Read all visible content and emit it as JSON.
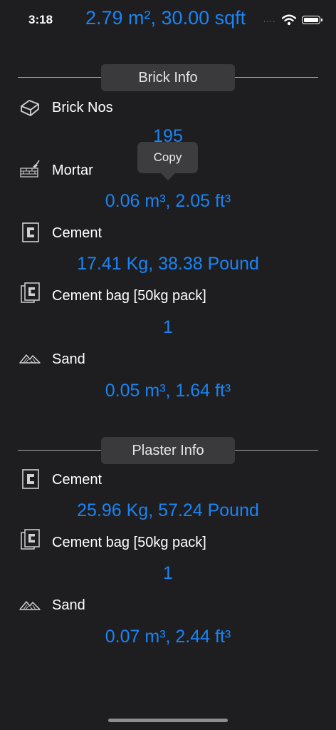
{
  "status_bar": {
    "time": "3:18",
    "signal_dots": "....",
    "area_text": "2.79 m², 30.00 sqft"
  },
  "brick_section": {
    "title": "Brick Info",
    "rows": [
      {
        "label": "Brick Nos",
        "value": "195",
        "icon": "brick-icon"
      },
      {
        "label": "Mortar",
        "value": "0.06 m³, 2.05 ft³",
        "icon": "mortar-trowel-icon"
      },
      {
        "label": "Cement",
        "value": "17.41 Kg, 38.38 Pound",
        "icon": "cement-icon"
      },
      {
        "label": "Cement bag [50kg pack]",
        "value": "1",
        "icon": "cement-bag-icon"
      },
      {
        "label": "Sand",
        "value": "0.05 m³, 1.64 ft³",
        "icon": "sand-icon"
      }
    ]
  },
  "plaster_section": {
    "title": "Plaster Info",
    "rows": [
      {
        "label": "Cement",
        "value": "25.96 Kg, 57.24 Pound",
        "icon": "cement-icon"
      },
      {
        "label": "Cement bag [50kg pack]",
        "value": "1",
        "icon": "cement-bag-icon"
      },
      {
        "label": "Sand",
        "value": "0.07 m³, 2.44 ft³",
        "icon": "sand-icon"
      }
    ]
  },
  "tooltip": {
    "label": "Copy"
  }
}
